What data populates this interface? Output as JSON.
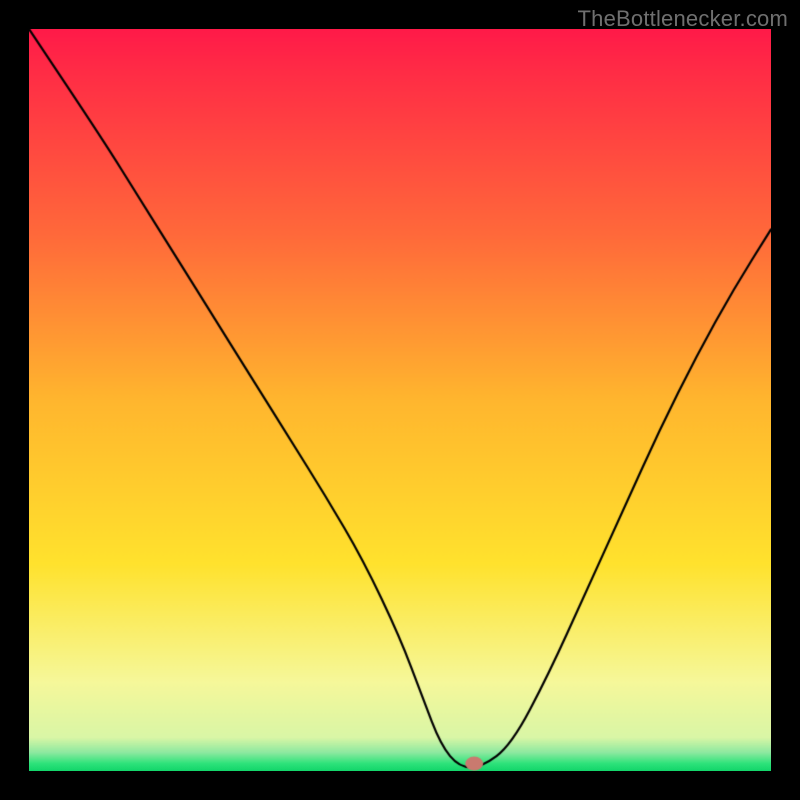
{
  "watermark": "TheBottlenecker.com",
  "chart_data": {
    "type": "line",
    "title": "",
    "xlabel": "",
    "ylabel": "",
    "xlim": [
      0,
      100
    ],
    "ylim": [
      0,
      100
    ],
    "x": [
      0,
      10,
      15,
      20,
      25,
      30,
      35,
      40,
      45,
      50,
      53,
      55.5,
      58,
      61,
      65,
      70,
      75,
      80,
      85,
      90,
      95,
      100
    ],
    "values": [
      100,
      85,
      77,
      69,
      61,
      53,
      45,
      37,
      28.5,
      18,
      10,
      3.5,
      0.5,
      0.5,
      3.5,
      13,
      24,
      35,
      46,
      56,
      65,
      73
    ],
    "marker": {
      "x": 60,
      "y": 1,
      "color": "#c97a6f"
    },
    "gradient_colors": {
      "top": "#ff1a49",
      "q1": "#ff6a3a",
      "mid": "#ffb62e",
      "q3": "#ffe22d",
      "low": "#f6f89a",
      "bottom": "#2ee37a"
    },
    "line_color": "#000000"
  }
}
